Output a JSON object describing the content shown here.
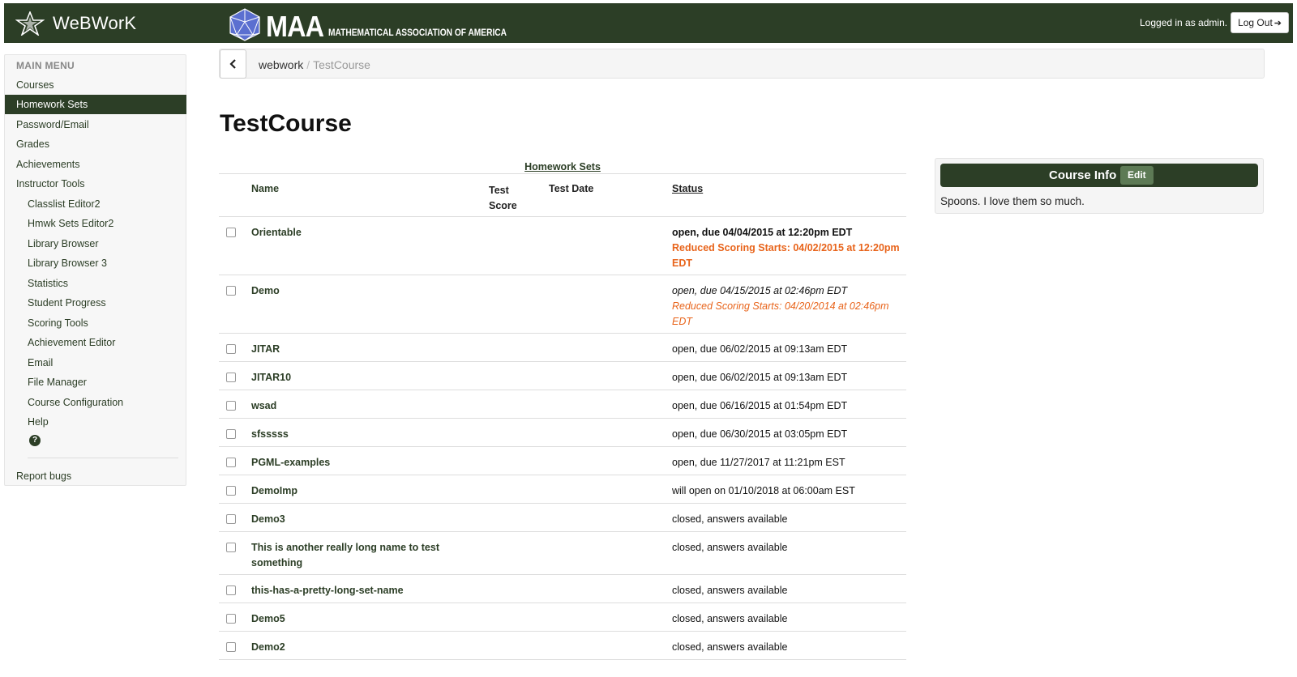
{
  "topbar": {
    "brand": "WeBWorK",
    "maa_short": "MAA",
    "maa_full": "MATHEMATICAL ASSOCIATION OF AMERICA",
    "logged_in_text": "Logged in as admin.",
    "logout_label": "Log Out",
    "colors": {
      "bar": "#2c3e26"
    }
  },
  "sidebar": {
    "header": "MAIN MENU",
    "items": [
      {
        "label": "Courses"
      },
      {
        "label": "Homework Sets",
        "active": true
      },
      {
        "label": "Password/Email"
      },
      {
        "label": "Grades"
      },
      {
        "label": "Achievements"
      },
      {
        "label": "Instructor Tools"
      },
      {
        "label": "Classlist Editor2"
      },
      {
        "label": "Hmwk Sets Editor2"
      },
      {
        "label": "Library Browser"
      },
      {
        "label": "Library Browser 3"
      },
      {
        "label": "Statistics"
      },
      {
        "label": "Student Progress"
      },
      {
        "label": "Scoring Tools"
      },
      {
        "label": "Achievement Editor"
      },
      {
        "label": "Email"
      },
      {
        "label": "File Manager"
      },
      {
        "label": "Course Configuration"
      },
      {
        "label": "Help"
      },
      {
        "label": "Report bugs"
      }
    ],
    "help_icon": "question-circle-icon"
  },
  "breadcrumb": {
    "root": "webwork",
    "separator": "/",
    "current": "TestCourse"
  },
  "page": {
    "title": "TestCourse"
  },
  "homework": {
    "caption": "Homework Sets",
    "headers": {
      "name": "Name",
      "test_score_1": "Test",
      "test_score_2": "Score",
      "test_date": "Test Date",
      "status": "Status"
    },
    "rows": [
      {
        "name": "Orientable",
        "status": "open, due 04/04/2015 at 12:20pm EDT",
        "reduced": "Reduced Scoring Starts: 04/02/2015 at 12:20pm EDT"
      },
      {
        "name": "Demo",
        "status": "open, due 04/15/2015 at 02:46pm EDT",
        "reduced": "Reduced Scoring Starts: 04/20/2014 at 02:46pm EDT"
      },
      {
        "name": "JITAR",
        "status": "open, due 06/02/2015 at 09:13am EDT"
      },
      {
        "name": "JITAR10",
        "status": "open, due 06/02/2015 at 09:13am EDT"
      },
      {
        "name": "wsad",
        "status": "open, due 06/16/2015 at 01:54pm EDT"
      },
      {
        "name": "sfsssss",
        "status": "open, due 06/30/2015 at 03:05pm EDT"
      },
      {
        "name": "PGML-examples",
        "status": "open, due 11/27/2017 at 11:21pm EST"
      },
      {
        "name": "DemoImp",
        "status": "will open on 01/10/2018 at 06:00am EST"
      },
      {
        "name": "Demo3",
        "status": "closed, answers available"
      },
      {
        "name": "This is another really long name to test something",
        "status": "closed, answers available"
      },
      {
        "name": "this-has-a-pretty-long-set-name",
        "status": "closed, answers available"
      },
      {
        "name": "Demo5",
        "status": "closed, answers available"
      },
      {
        "name": "Demo2",
        "status": "closed, answers available"
      }
    ]
  },
  "course_info": {
    "title": "Course Info",
    "edit_label": "Edit",
    "body": "Spoons. I love them so much."
  }
}
